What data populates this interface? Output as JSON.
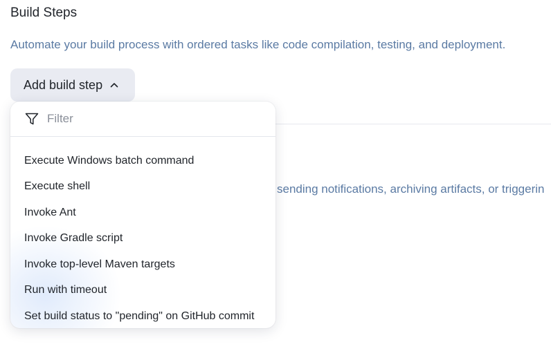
{
  "section": {
    "title": "Build Steps",
    "description": "Automate your build process with ordered tasks like code compilation, testing, and deployment."
  },
  "add_step_button": {
    "label": "Add build step",
    "icon": "chevron-up-icon"
  },
  "background": {
    "post_build_description_fragment": "sending notifications, archiving artifacts, or triggerin"
  },
  "dropdown": {
    "filter": {
      "icon": "funnel-icon",
      "placeholder": "Filter",
      "value": ""
    },
    "items": [
      {
        "label": "Execute Windows batch command"
      },
      {
        "label": "Execute shell"
      },
      {
        "label": "Invoke Ant"
      },
      {
        "label": "Invoke Gradle script"
      },
      {
        "label": "Invoke top-level Maven targets"
      },
      {
        "label": "Run with timeout"
      },
      {
        "label": "Set build status to \"pending\" on GitHub commit"
      }
    ]
  },
  "colors": {
    "text": "#1f2329",
    "description": "#5a7aa3",
    "button_bg": "#e9ebf2",
    "divider": "#e3e6ec"
  }
}
